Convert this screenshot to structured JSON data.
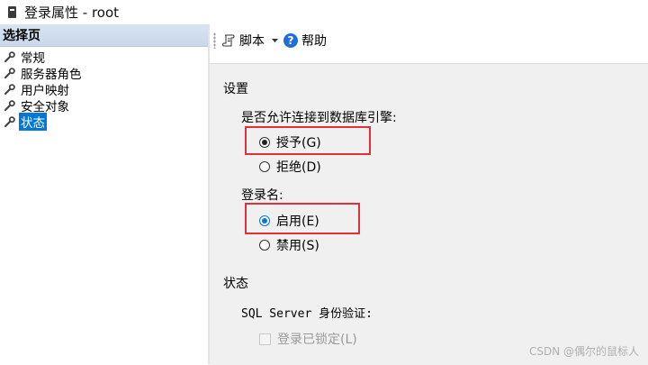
{
  "window": {
    "title": "登录属性 - root"
  },
  "left_panel": {
    "header": "选择页",
    "items": [
      {
        "label": "常规",
        "selected": false
      },
      {
        "label": "服务器角色",
        "selected": false
      },
      {
        "label": "用户映射",
        "selected": false
      },
      {
        "label": "安全对象",
        "selected": false
      },
      {
        "label": "状态",
        "selected": true
      }
    ]
  },
  "toolbar": {
    "script_label": "脚本",
    "help_label": "帮助",
    "help_icon_glyph": "?"
  },
  "settings": {
    "section_title": "设置",
    "db_engine_question": "是否允许连接到数据库引擎:",
    "grant_label": "授予(G)",
    "deny_label": "拒绝(D)",
    "grant_selected": true,
    "login_label": "登录名:",
    "enable_label": "启用(E)",
    "disable_label": "禁用(S)",
    "enable_selected": true
  },
  "status": {
    "section_title": "状态",
    "auth_label": "SQL Server 身份验证:",
    "locked_label": "登录已锁定(L)",
    "locked_checked": false
  },
  "watermark": "CSDN @偶尔的鼠标人",
  "colors": {
    "accent": "#0078d7",
    "highlight": "#e0303a",
    "panel_bg": "#f0f0f0"
  }
}
